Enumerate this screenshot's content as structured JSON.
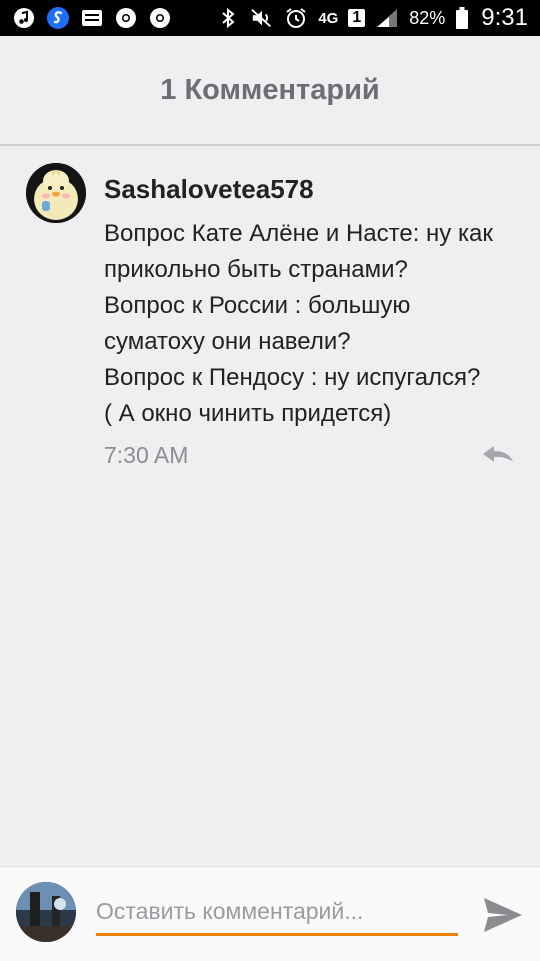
{
  "status_bar": {
    "battery": "82%",
    "time": "9:31",
    "network": "4G",
    "sim": "1",
    "icons": [
      "music-icon",
      "shazam-icon",
      "drive-icon",
      "chrome-icon",
      "chrome-icon",
      "bluetooth-icon",
      "mute-icon",
      "alarm-icon",
      "signal-icon",
      "battery-icon"
    ]
  },
  "header": {
    "title": "1 Комментарий"
  },
  "comment": {
    "author": "Sashalovetea578",
    "lines": [
      "Вопрос Кате Алёне и Насте: ну как",
      "прикольно быть странами?",
      "Вопрос к России : большую",
      "суматоху они навели?",
      "Вопрос к Пендосу : ну испугался?",
      "( А окно чинить придется)"
    ],
    "time": "7:30 AM"
  },
  "input": {
    "placeholder": "Оставить комментарий...",
    "value": ""
  },
  "colors": {
    "accent": "#ee8208",
    "background": "#efeef1",
    "header_text": "#6e6e72"
  }
}
